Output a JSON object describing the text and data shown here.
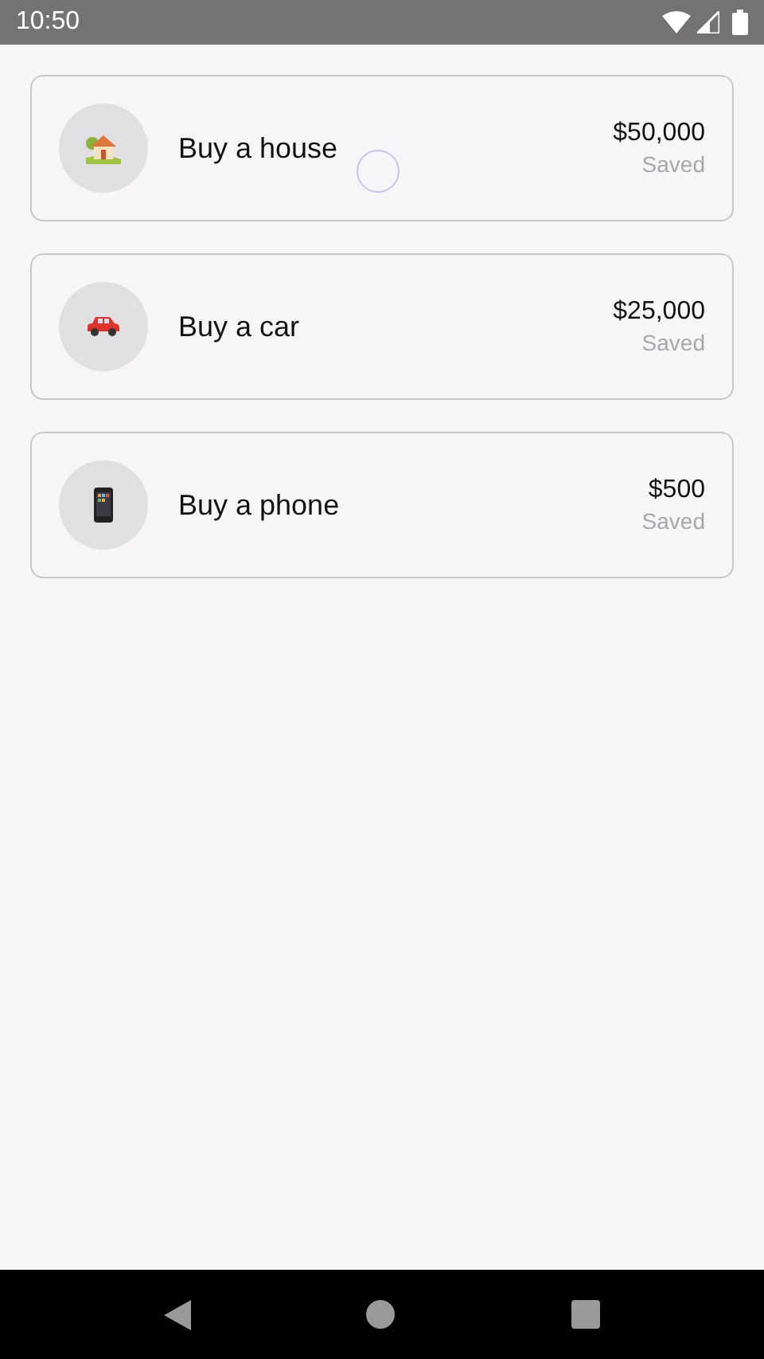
{
  "status_bar": {
    "time": "10:50"
  },
  "goals": [
    {
      "kind": "house",
      "title": "Buy a house",
      "amount": "$50,000",
      "caption": "Saved"
    },
    {
      "kind": "car",
      "title": "Buy a car",
      "amount": "$25,000",
      "caption": "Saved"
    },
    {
      "kind": "phone",
      "title": "Buy a phone",
      "amount": "$500",
      "caption": "Saved"
    }
  ]
}
